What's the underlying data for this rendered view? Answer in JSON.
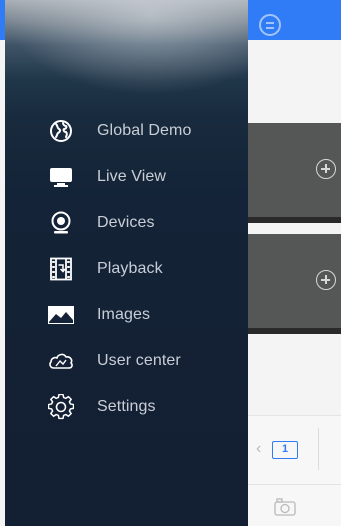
{
  "menu": {
    "items": [
      {
        "label": "Global Demo",
        "icon": "globe-icon"
      },
      {
        "label": "Live View",
        "icon": "monitor-icon"
      },
      {
        "label": "Devices",
        "icon": "camera-icon"
      },
      {
        "label": "Playback",
        "icon": "film-playback-icon"
      },
      {
        "label": "Images",
        "icon": "image-icon"
      },
      {
        "label": "User center",
        "icon": "cloud-icon"
      },
      {
        "label": "Settings",
        "icon": "gear-icon"
      }
    ]
  },
  "app": {
    "page_number": "1",
    "accent_color": "#2f7cf6"
  },
  "colors": {
    "drawer_bg": "#131f33",
    "menu_text": "#c9ced6",
    "tile_bg": "#555656"
  }
}
